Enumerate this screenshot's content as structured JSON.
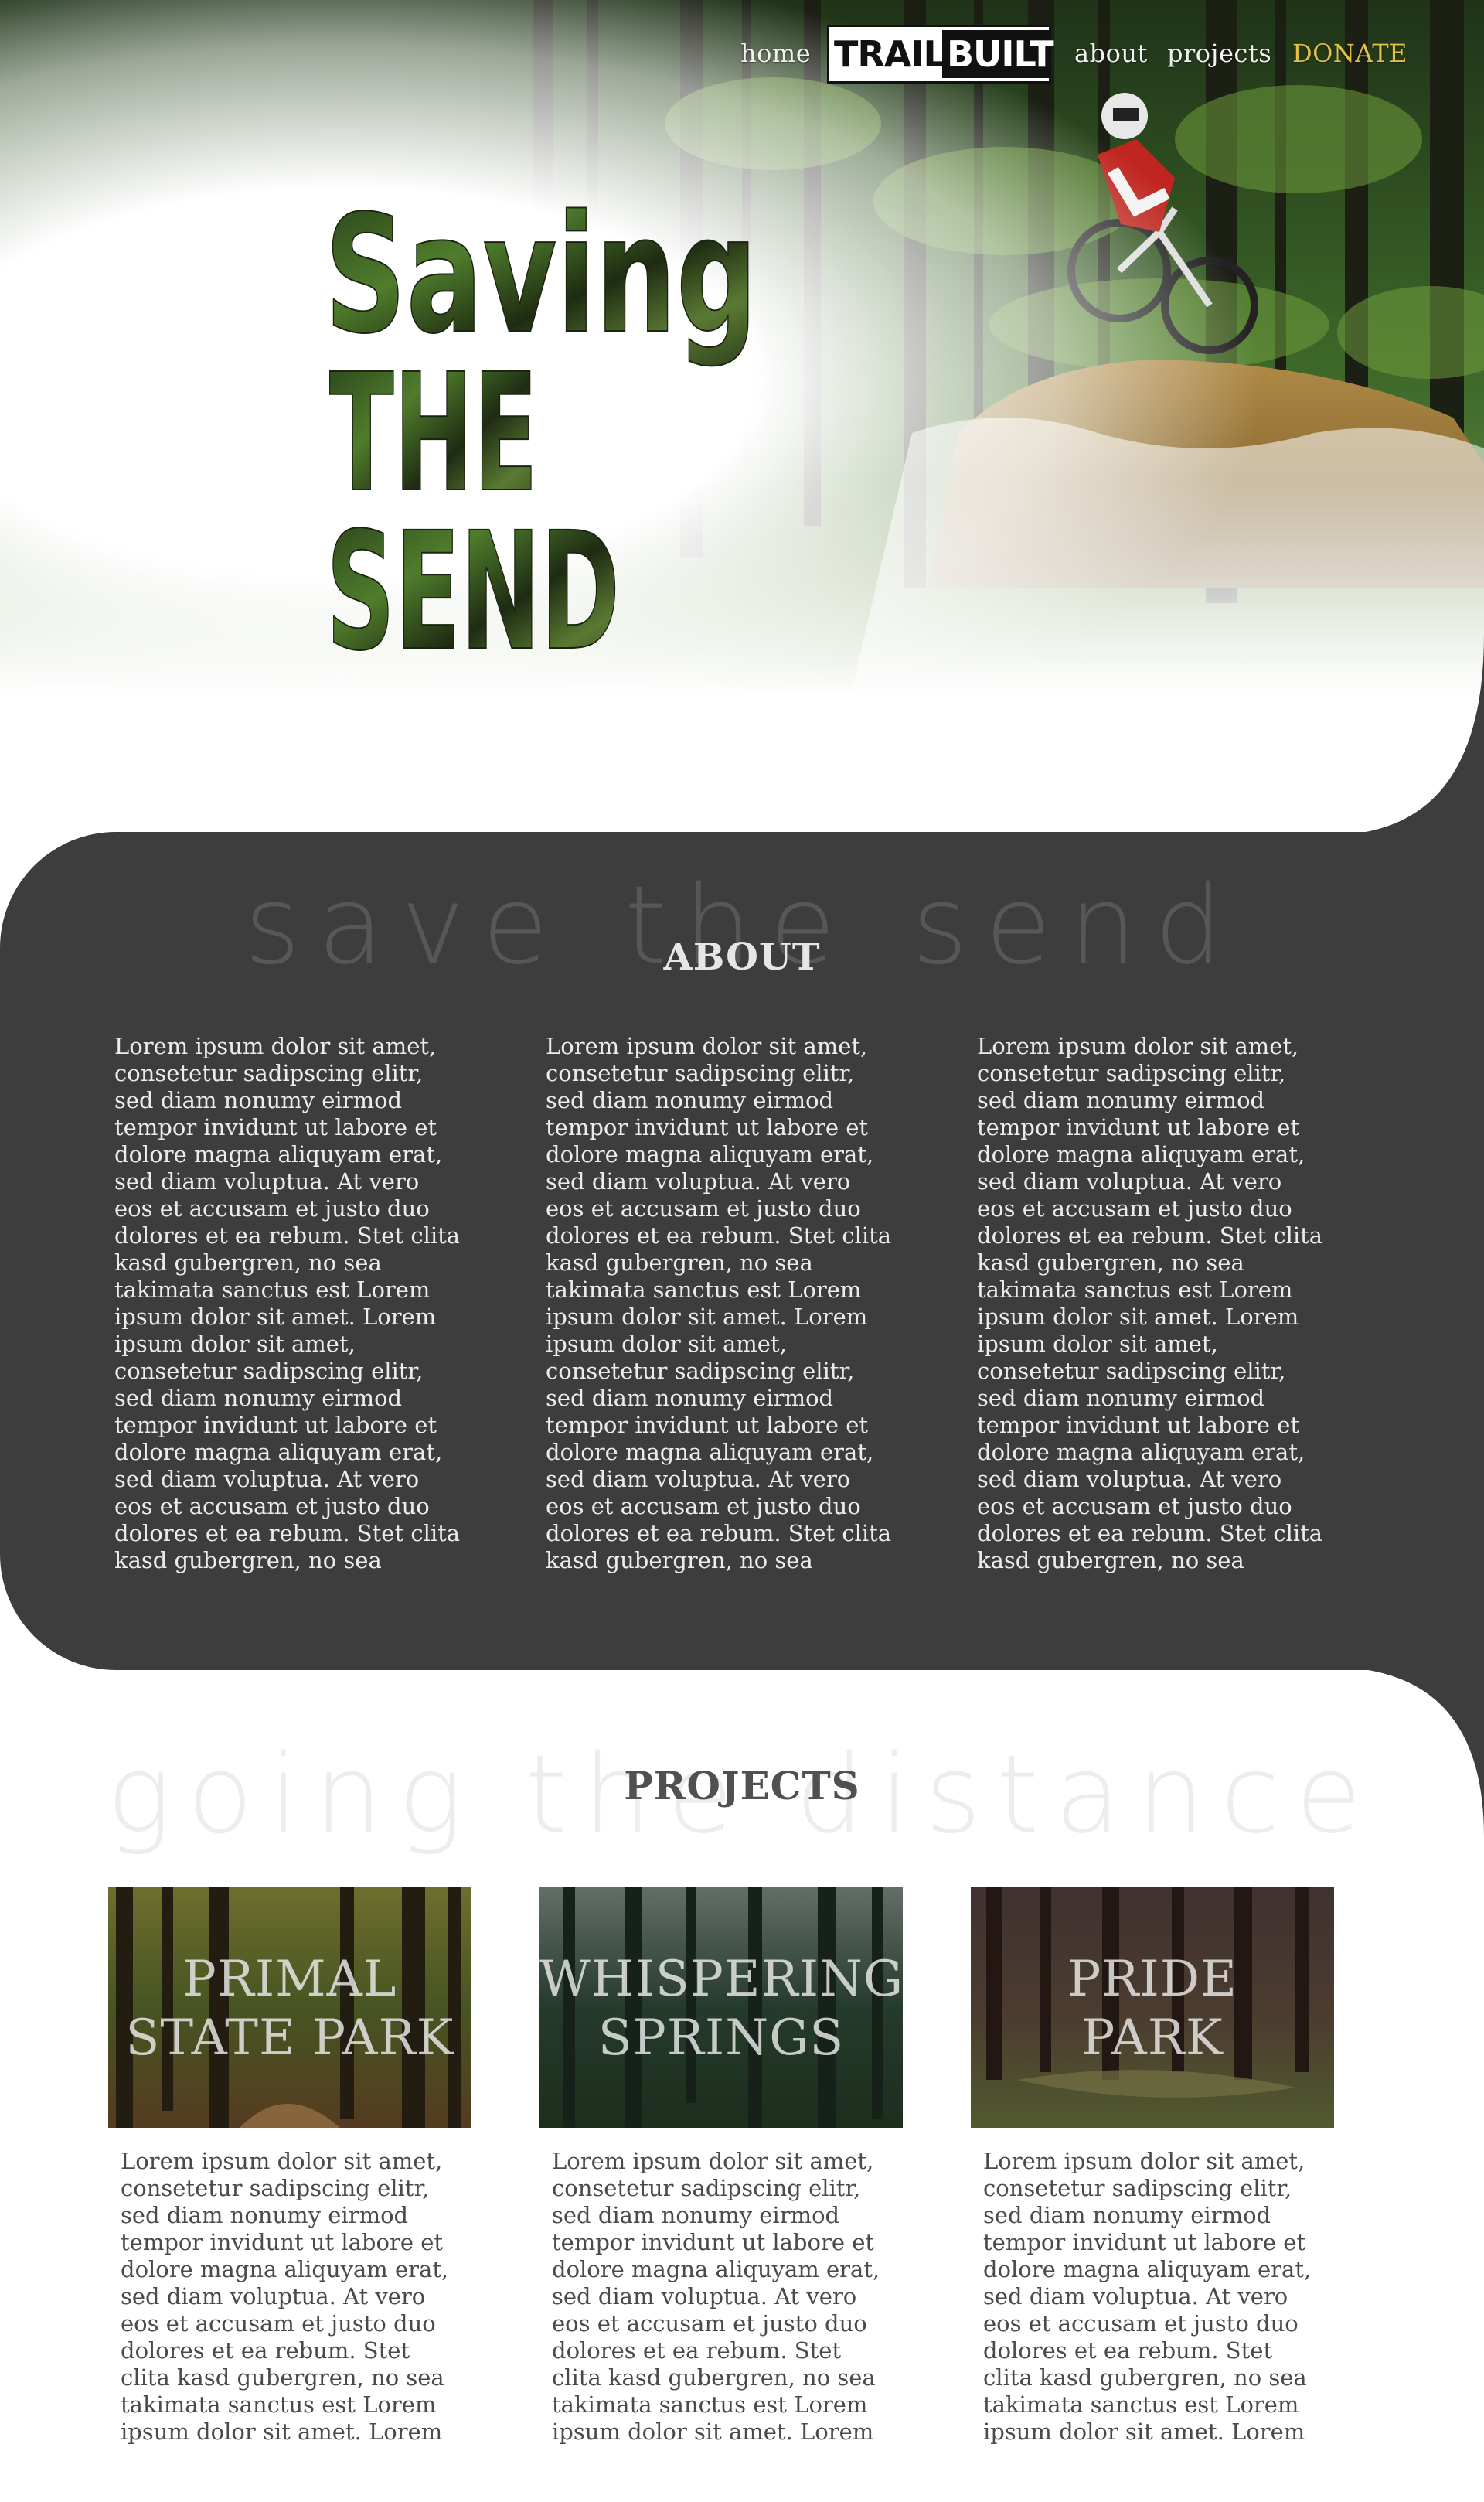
{
  "nav": {
    "home": "home",
    "logo_trail": "TRAIL",
    "logo_built": "BUILT",
    "about": "about",
    "projects": "projects",
    "donate": "DONATE"
  },
  "hero": {
    "title_line1": "Saving",
    "title_line2": "THE",
    "title_line3": "SEND"
  },
  "about": {
    "script": [
      "save",
      "the",
      "send"
    ],
    "title": "ABOUT",
    "columns": [
      "Lorem ipsum dolor sit amet, consetetur sadipscing elitr, sed diam nonumy eirmod tempor invidunt ut labore et dolore magna aliquyam erat, sed diam voluptua. At vero eos et accusam et justo duo dolores et ea rebum. Stet clita kasd gubergren, no sea takimata sanctus est Lorem ipsum dolor sit amet. Lorem ipsum dolor sit amet, consetetur sadipscing elitr, sed diam nonumy eirmod tempor invidunt ut labore et dolore magna aliquyam erat, sed diam voluptua. At vero eos et accusam et justo duo dolores et ea rebum. Stet clita kasd gubergren, no sea",
      "Lorem ipsum dolor sit amet, consetetur sadipscing elitr, sed diam nonumy eirmod tempor invidunt ut labore et dolore magna aliquyam erat, sed diam voluptua. At vero eos et accusam et justo duo dolores et ea rebum. Stet clita kasd gubergren, no sea takimata sanctus est Lorem ipsum dolor sit amet. Lorem ipsum dolor sit amet, consetetur sadipscing elitr, sed diam nonumy eirmod tempor invidunt ut labore et dolore magna aliquyam erat, sed diam voluptua. At vero eos et accusam et justo duo dolores et ea rebum. Stet clita kasd gubergren, no sea",
      "Lorem ipsum dolor sit amet, consetetur sadipscing elitr, sed diam nonumy eirmod tempor invidunt ut labore et dolore magna aliquyam erat, sed diam voluptua. At vero eos et accusam et justo duo dolores et ea rebum. Stet clita kasd gubergren, no sea takimata sanctus est Lorem ipsum dolor sit amet. Lorem ipsum dolor sit amet, consetetur sadipscing elitr, sed diam nonumy eirmod tempor invidunt ut labore et dolore magna aliquyam erat, sed diam voluptua. At vero eos et accusam et justo duo dolores et ea rebum. Stet clita kasd gubergren, no sea"
    ]
  },
  "projects": {
    "script": [
      "going",
      "the",
      "distance"
    ],
    "title": "PROJECTS",
    "cards": [
      {
        "line1": "PRIMAL",
        "line2": "STATE PARK",
        "text": "Lorem ipsum dolor sit amet, consetetur sadipscing elitr, sed diam nonumy eirmod tempor invidunt ut labore et dolore magna aliquyam erat, sed diam voluptua. At vero eos et accusam et justo duo dolores et ea rebum. Stet clita kasd gubergren, no sea takimata sanctus est Lorem ipsum dolor sit amet. Lorem"
      },
      {
        "line1": "WHISPERING",
        "line2": "SPRINGS",
        "text": "Lorem ipsum dolor sit amet, consetetur sadipscing elitr, sed diam nonumy eirmod tempor invidunt ut labore et dolore magna aliquyam erat, sed diam voluptua. At vero eos et accusam et justo duo dolores et ea rebum. Stet clita kasd gubergren, no sea takimata sanctus est Lorem ipsum dolor sit amet. Lorem"
      },
      {
        "line1": "PRIDE",
        "line2": "PARK",
        "text": "Lorem ipsum dolor sit amet, consetetur sadipscing elitr, sed diam nonumy eirmod tempor invidunt ut labore et dolore magna aliquyam erat, sed diam voluptua. At vero eos et accusam et justo duo dolores et ea rebum. Stet clita kasd gubergren, no sea takimata sanctus est Lorem ipsum dolor sit amet. Lorem"
      }
    ]
  },
  "colors": {
    "dark_panel": "#3d3d3d",
    "donate": "#e2c146",
    "forest_green": "#3d6a25",
    "dirt": "#9a7a3a"
  }
}
